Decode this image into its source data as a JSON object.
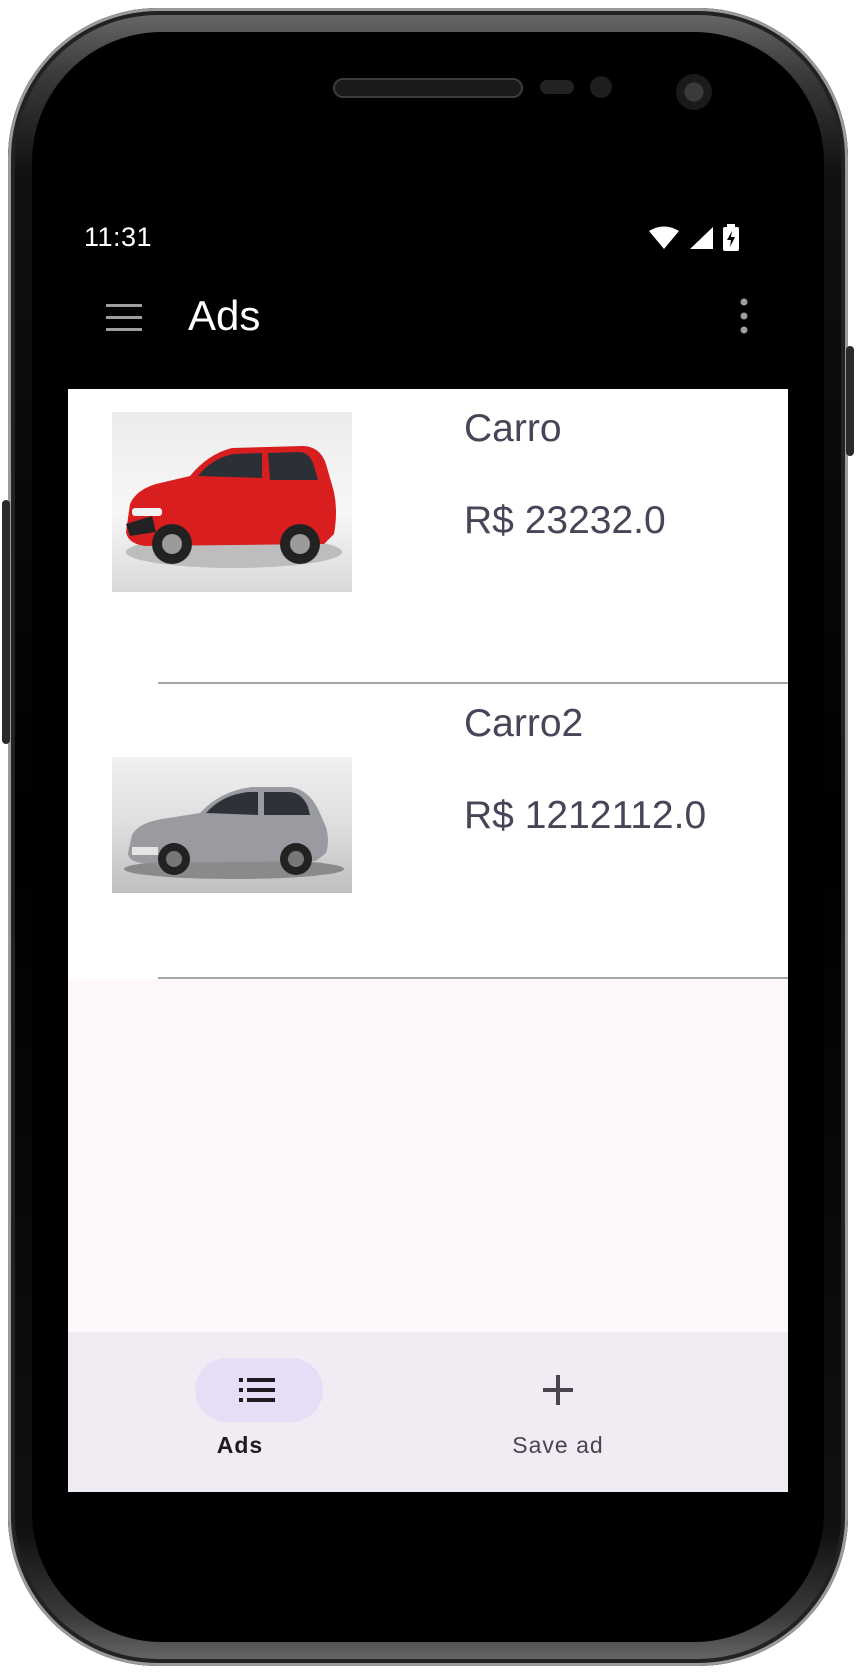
{
  "status_bar": {
    "time": "11:31",
    "icons": [
      "wifi-icon",
      "signal-icon",
      "battery-charging-icon"
    ]
  },
  "app_bar": {
    "title": "Ads",
    "menu_icon": "hamburger-menu-icon",
    "overflow_icon": "more-vert-icon"
  },
  "ads": [
    {
      "name": "Carro",
      "price": "R$ 23232.0",
      "image": "red-hatchback-car",
      "car_color": "#d81e1e"
    },
    {
      "name": "Carro2",
      "price": "R$ 1212112.0",
      "image": "silver-hatchback-car",
      "car_color": "#9a9ba0"
    }
  ],
  "bottom_nav": {
    "items": [
      {
        "label": "Ads",
        "icon": "list-icon",
        "selected": true
      },
      {
        "label": "Save ad",
        "icon": "add-icon",
        "selected": false
      }
    ]
  },
  "colors": {
    "background": "#fef7fb",
    "bottom_nav_bg": "#f1ebf3",
    "selected_pill": "#e8ddf6",
    "text_secondary": "#4a4458"
  }
}
